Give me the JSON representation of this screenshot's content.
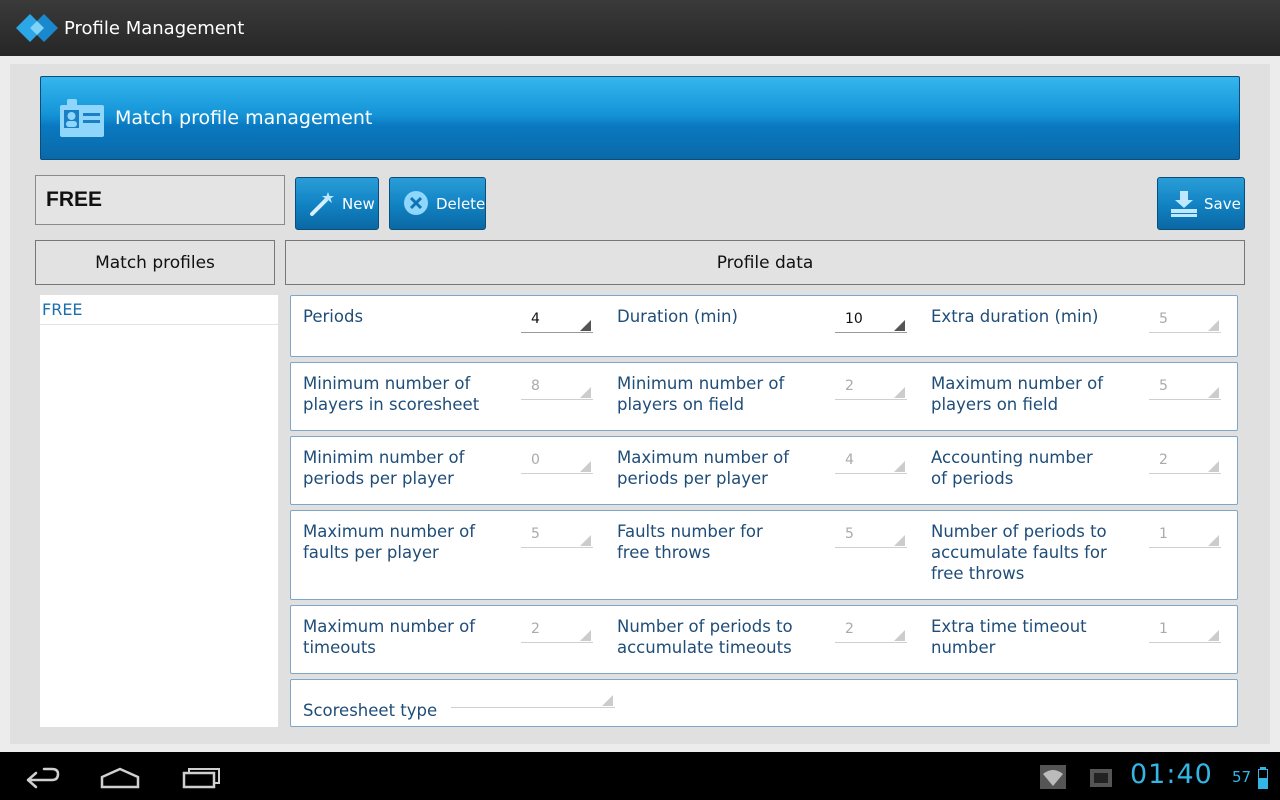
{
  "app": {
    "title": "Profile Management"
  },
  "banner": {
    "title": "Match profile management"
  },
  "toolbar": {
    "profile_name": "FREE",
    "new_label": "New",
    "delete_label": "Delete",
    "save_label": "Save"
  },
  "headers": {
    "profiles": "Match profiles",
    "data": "Profile data"
  },
  "profiles": [
    {
      "name": "FREE"
    }
  ],
  "rows": [
    {
      "fields": [
        {
          "label": "Periods",
          "value": "4",
          "active": true
        },
        {
          "label": "Duration (min)",
          "value": "10",
          "active": true
        },
        {
          "label": "Extra duration (min)",
          "value": "5",
          "active": false
        }
      ]
    },
    {
      "fields": [
        {
          "label": "Minimum number of players in scoresheet",
          "value": "8",
          "active": false
        },
        {
          "label": "Minimum number of players on field",
          "value": "2",
          "active": false
        },
        {
          "label": "Maximum number of players on field",
          "value": "5",
          "active": false
        }
      ]
    },
    {
      "fields": [
        {
          "label": "Minimim number of periods per player",
          "value": "0",
          "active": false
        },
        {
          "label": "Maximum number of periods per player",
          "value": "4",
          "active": false
        },
        {
          "label": "Accounting number of periods",
          "value": "2",
          "active": false
        }
      ]
    },
    {
      "fields": [
        {
          "label": "Maximum number of faults per player",
          "value": "5",
          "active": false
        },
        {
          "label": "Faults number for free throws",
          "value": "5",
          "active": false
        },
        {
          "label": "Number of periods to accumulate faults for free throws",
          "value": "1",
          "active": false
        }
      ]
    },
    {
      "fields": [
        {
          "label": "Maximum number of timeouts",
          "value": "2",
          "active": false
        },
        {
          "label": "Number of periods to accumulate timeouts",
          "value": "2",
          "active": false
        },
        {
          "label": "Extra time timeout number",
          "value": "1",
          "active": false
        }
      ]
    }
  ],
  "scoresheet": {
    "label": "Scoresheet type"
  },
  "statusbar": {
    "time": "01:40",
    "battery": "57"
  },
  "colors": {
    "accent": "#1283c4",
    "label_text": "#1f4d78",
    "status_blue": "#33b5e5"
  }
}
